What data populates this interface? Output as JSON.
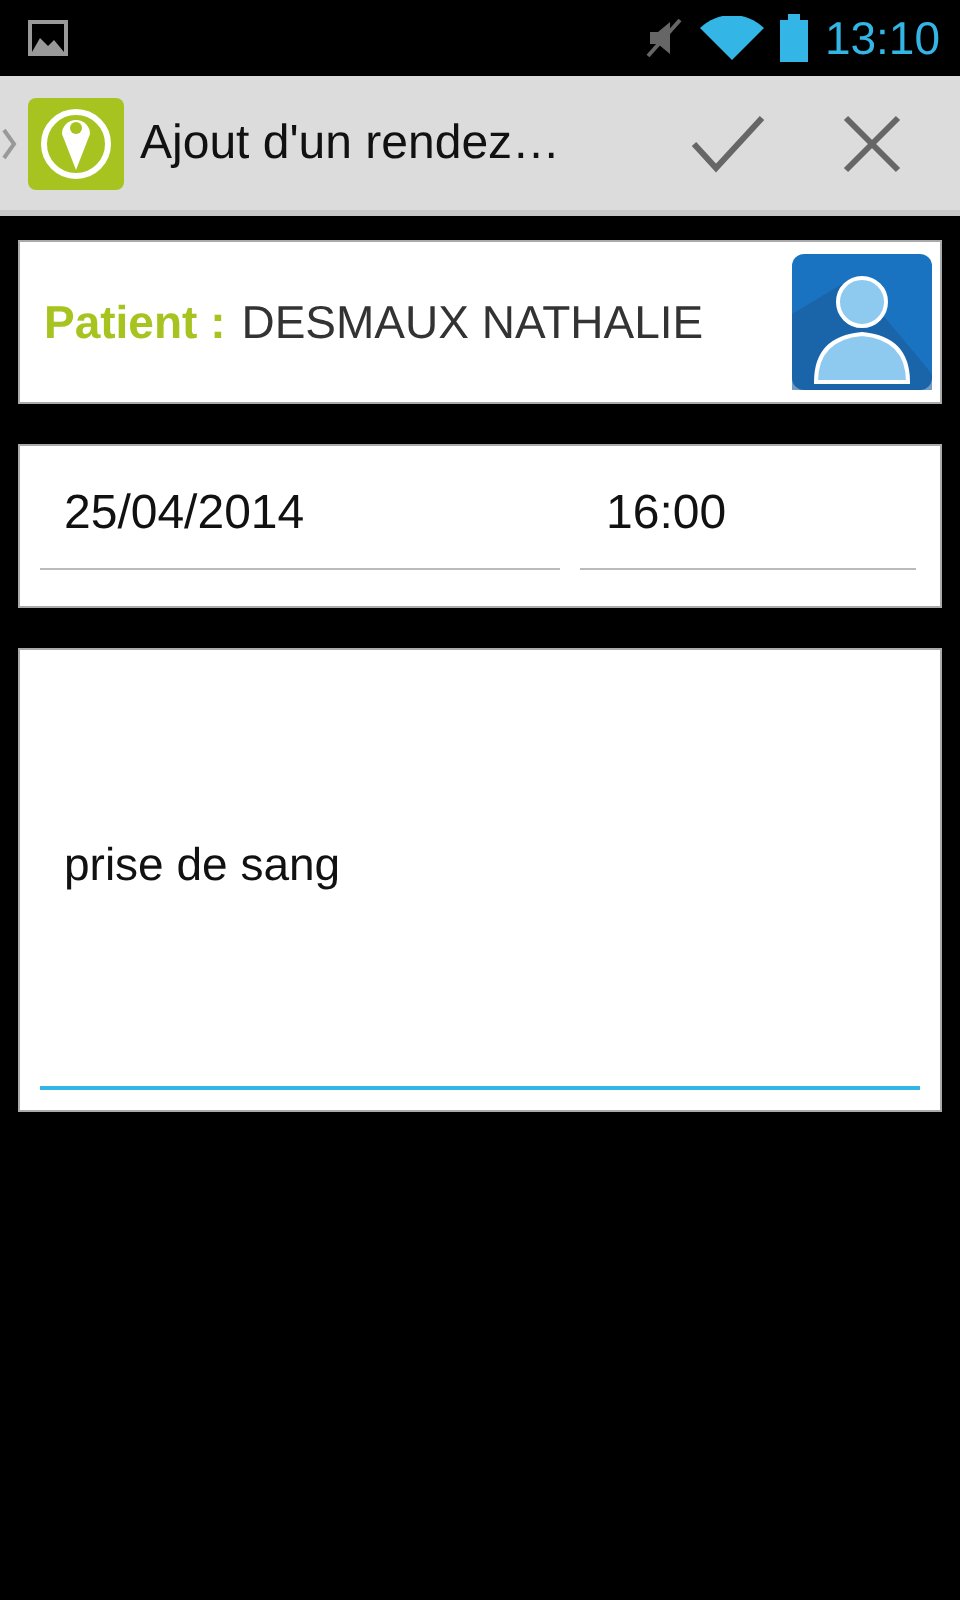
{
  "status_bar": {
    "time": "13:10"
  },
  "action_bar": {
    "title": "Ajout d'un rendez…"
  },
  "patient": {
    "label": "Patient :",
    "name": "DESMAUX NATHALIE"
  },
  "date_field": {
    "value": "25/04/2014"
  },
  "time_field": {
    "value": "16:00"
  },
  "note_field": {
    "value": "prise de sang",
    "focused": true
  }
}
